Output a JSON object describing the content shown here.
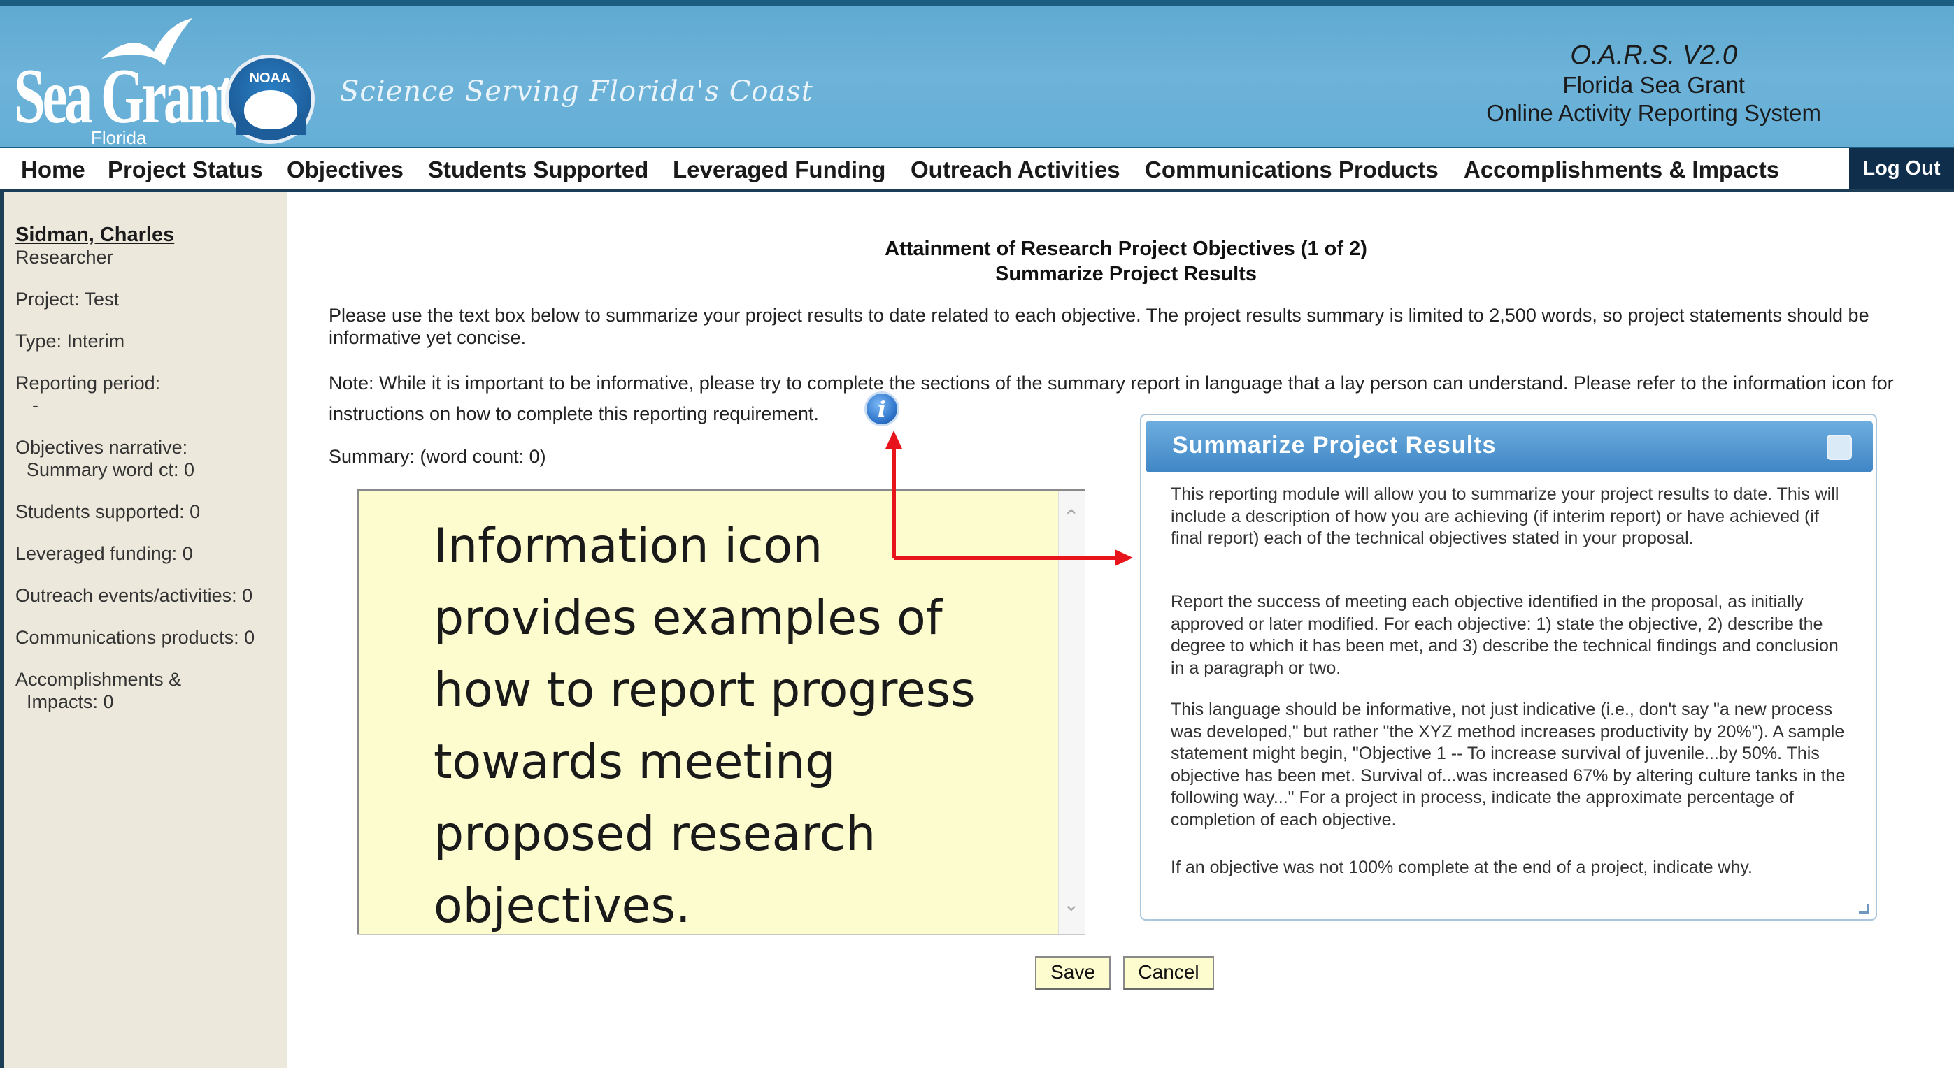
{
  "branding": {
    "logo_wordmark": "Sea Grant",
    "logo_sub": "Florida",
    "noaa_text": "NOAA",
    "tagline": "Science Serving Florida's Coast"
  },
  "system": {
    "line1": "O.A.R.S. V2.0",
    "line2": "Florida Sea Grant",
    "line3": "Online Activity Reporting System"
  },
  "nav": {
    "items": [
      {
        "label": "Home"
      },
      {
        "label": "Project Status"
      },
      {
        "label": "Objectives"
      },
      {
        "label": "Students Supported"
      },
      {
        "label": "Leveraged Funding"
      },
      {
        "label": "Outreach Activities"
      },
      {
        "label": "Communications Products"
      },
      {
        "label": "Accomplishments & Impacts"
      }
    ],
    "logout": "Log Out"
  },
  "sidebar": {
    "user_name": "Sidman, Charles",
    "user_role": "Researcher",
    "project": "Project: Test",
    "type": "Type: Interim",
    "reporting_period": "Reporting period:",
    "reporting_period_value": "-",
    "objectives_narrative": "Objectives narrative:",
    "summary_word_ct": "Summary word ct: 0",
    "students_supported": "Students supported: 0",
    "leveraged_funding": "Leveraged funding: 0",
    "outreach": "Outreach events/activities: 0",
    "communications": "Communications products: 0",
    "accomplishments": "Accomplishments &",
    "impacts": "Impacts: 0"
  },
  "main": {
    "heading1": "Attainment of Research Project Objectives (1 of 2)",
    "heading2": "Summarize Project Results",
    "instructions": "Please use the text box below to summarize your project results to date related to each objective. The project results summary is limited to 2,500 words, so project statements should be informative yet concise.",
    "note": "Note: While it is important to be informative, please try to complete the sections of the summary report in language that a lay person can understand. Please refer to the information icon for instructions on how to complete this reporting requirement.",
    "info_icon_glyph": "i",
    "summary_label": "Summary: (word count: 0)",
    "summary_value": ""
  },
  "annotation": {
    "lines": [
      "Information icon",
      "provides examples of",
      "how to report progress",
      "towards meeting",
      "proposed research",
      "objectives."
    ],
    "arrow_color": "#e8141b"
  },
  "help_panel": {
    "title": "Summarize Project Results",
    "paragraphs": [
      "This reporting module will allow you to summarize your project results to date. This will include a description of how you are achieving (if interim report) or have achieved (if final report) each of the technical objectives stated in your proposal.",
      "Report the success of meeting each objective identified in the proposal, as initially approved or later modified. For each objective: 1) state the objective, 2) describe the degree to which it has been met, and 3) describe the technical findings and conclusion in a paragraph or two.",
      "This language should be informative, not just indicative (i.e., don't say \"a new process was developed,\" but rather \"the XYZ method increases productivity by 20%\"). A sample statement might begin, \"Objective 1 -- To increase survival of juvenile...by 50%. This objective has been met. Survival of...was increased 67% by altering culture tanks in the following way...\" For a project in process, indicate the approximate percentage of completion of each objective.",
      "If an objective was not 100% complete at the end of a project, indicate why."
    ]
  },
  "buttons": {
    "save": "Save",
    "cancel": "Cancel"
  },
  "colors": {
    "banner": "#6eb3d9",
    "nav_border": "#1c3f57",
    "sidebar_bg": "#ece9dc",
    "textbox_bg": "#fdfcce",
    "help_header": "#3f86c6",
    "annotation_arrow": "#e8141b"
  }
}
